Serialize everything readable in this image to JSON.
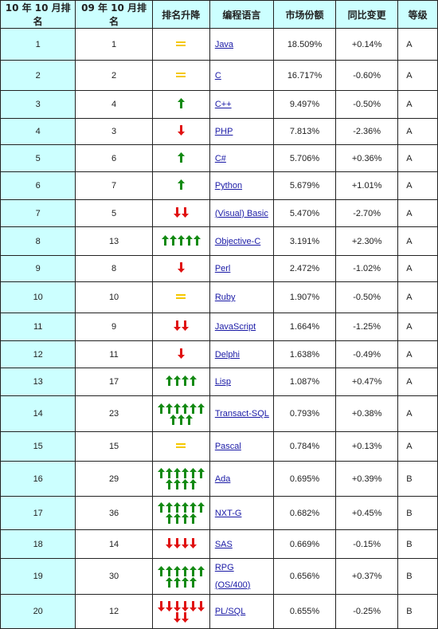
{
  "headers": [
    "10 年 10 月排名",
    "09 年 10 月排名",
    "排名升降",
    "编程语言",
    "市场份额",
    "同比变更",
    "等级"
  ],
  "colors": {
    "up": "#138a13",
    "down": "#e01010",
    "same": "#f5c800",
    "rank_bg": "#ccffff",
    "link": "#1a1aa6"
  },
  "rows": [
    {
      "rank": "1",
      "prev": "1",
      "trend": "same",
      "count": 0,
      "lang": "Java",
      "share": "18.509%",
      "change": "+0.14%",
      "grade": "A"
    },
    {
      "rank": "2",
      "prev": "2",
      "trend": "same",
      "count": 0,
      "lang": "C",
      "share": "16.717%",
      "change": "-0.60%",
      "grade": "A"
    },
    {
      "rank": "3",
      "prev": "4",
      "trend": "up",
      "count": 1,
      "lang": "C++",
      "share": "9.497%",
      "change": "-0.50%",
      "grade": "A"
    },
    {
      "rank": "4",
      "prev": "3",
      "trend": "down",
      "count": 1,
      "lang": "PHP",
      "share": "7.813%",
      "change": "-2.36%",
      "grade": "A"
    },
    {
      "rank": "5",
      "prev": "6",
      "trend": "up",
      "count": 1,
      "lang": "C#",
      "share": "5.706%",
      "change": "+0.36%",
      "grade": "A"
    },
    {
      "rank": "6",
      "prev": "7",
      "trend": "up",
      "count": 1,
      "lang": "Python",
      "share": "5.679%",
      "change": "+1.01%",
      "grade": "A"
    },
    {
      "rank": "7",
      "prev": "5",
      "trend": "down",
      "count": 2,
      "lang": "(Visual) Basic",
      "share": "5.470%",
      "change": "-2.70%",
      "grade": "A"
    },
    {
      "rank": "8",
      "prev": "13",
      "trend": "up",
      "count": 5,
      "lang": "Objective-C",
      "share": "3.191%",
      "change": "+2.30%",
      "grade": "A"
    },
    {
      "rank": "9",
      "prev": "8",
      "trend": "down",
      "count": 1,
      "lang": "Perl",
      "share": "2.472%",
      "change": "-1.02%",
      "grade": "A"
    },
    {
      "rank": "10",
      "prev": "10",
      "trend": "same",
      "count": 0,
      "lang": "Ruby",
      "share": "1.907%",
      "change": "-0.50%",
      "grade": "A"
    },
    {
      "rank": "11",
      "prev": "9",
      "trend": "down",
      "count": 2,
      "lang": "JavaScript",
      "share": "1.664%",
      "change": "-1.25%",
      "grade": "A"
    },
    {
      "rank": "12",
      "prev": "11",
      "trend": "down",
      "count": 1,
      "lang": "Delphi",
      "share": "1.638%",
      "change": "-0.49%",
      "grade": "A"
    },
    {
      "rank": "13",
      "prev": "17",
      "trend": "up",
      "count": 4,
      "lang": "Lisp",
      "share": "1.087%",
      "change": "+0.47%",
      "grade": "A"
    },
    {
      "rank": "14",
      "prev": "23",
      "trend": "up",
      "count": 9,
      "lang": "Transact-SQL",
      "share": "0.793%",
      "change": "+0.38%",
      "grade": "A"
    },
    {
      "rank": "15",
      "prev": "15",
      "trend": "same",
      "count": 0,
      "lang": "Pascal",
      "share": "0.784%",
      "change": "+0.13%",
      "grade": "A"
    },
    {
      "rank": "16",
      "prev": "29",
      "trend": "up",
      "count": 10,
      "lang": "Ada",
      "share": "0.695%",
      "change": "+0.39%",
      "grade": "B"
    },
    {
      "rank": "17",
      "prev": "36",
      "trend": "up",
      "count": 10,
      "lang": "NXT-G",
      "share": "0.682%",
      "change": "+0.45%",
      "grade": "B"
    },
    {
      "rank": "18",
      "prev": "14",
      "trend": "down",
      "count": 4,
      "lang": "SAS",
      "share": "0.669%",
      "change": "-0.15%",
      "grade": "B"
    },
    {
      "rank": "19",
      "prev": "30",
      "trend": "up",
      "count": 10,
      "lang": "RPG (OS/400)",
      "share": "0.656%",
      "change": "+0.37%",
      "grade": "B"
    },
    {
      "rank": "20",
      "prev": "12",
      "trend": "down",
      "count": 8,
      "lang": "PL/SQL",
      "share": "0.655%",
      "change": "-0.25%",
      "grade": "B"
    }
  ]
}
